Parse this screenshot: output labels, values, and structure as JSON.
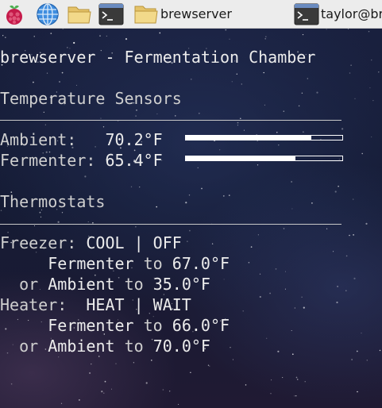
{
  "taskbar": {
    "launchers": [
      {
        "icon": "raspberry-pi-menu-icon"
      },
      {
        "icon": "web-browser-icon"
      },
      {
        "icon": "file-manager-icon"
      },
      {
        "icon": "terminal-icon"
      }
    ],
    "tasks": [
      {
        "icon": "folder-icon",
        "label": "brewserver"
      },
      {
        "icon": "terminal-icon",
        "label": "taylor@bre"
      }
    ]
  },
  "screen": {
    "title": "brewserver - Fermentation Chamber",
    "sensors_heading": "Temperature Sensors",
    "sensors": [
      {
        "label": "Ambient:  ",
        "value": "70.2°F",
        "bar_fraction": 0.8
      },
      {
        "label": "Fermenter:",
        "value": "65.4°F",
        "bar_fraction": 0.7
      }
    ],
    "thermostats_heading": "Thermostats",
    "freezer": {
      "label": "Freezer:",
      "mode": "COOL | OFF",
      "line1_target": "Fermenter",
      "line1_to": "to",
      "line1_value": "67.0°F",
      "line2_or": "or",
      "line2_target": "Ambient",
      "line2_to": "to",
      "line2_value": "35.0°F"
    },
    "heater": {
      "label": "Heater:",
      "mode": "HEAT | WAIT",
      "line1_target": "Fermenter",
      "line1_to": "to",
      "line1_value": "66.0°F",
      "line2_or": "or",
      "line2_target": "Ambient",
      "line2_to": "to",
      "line2_value": "70.0°F"
    }
  }
}
